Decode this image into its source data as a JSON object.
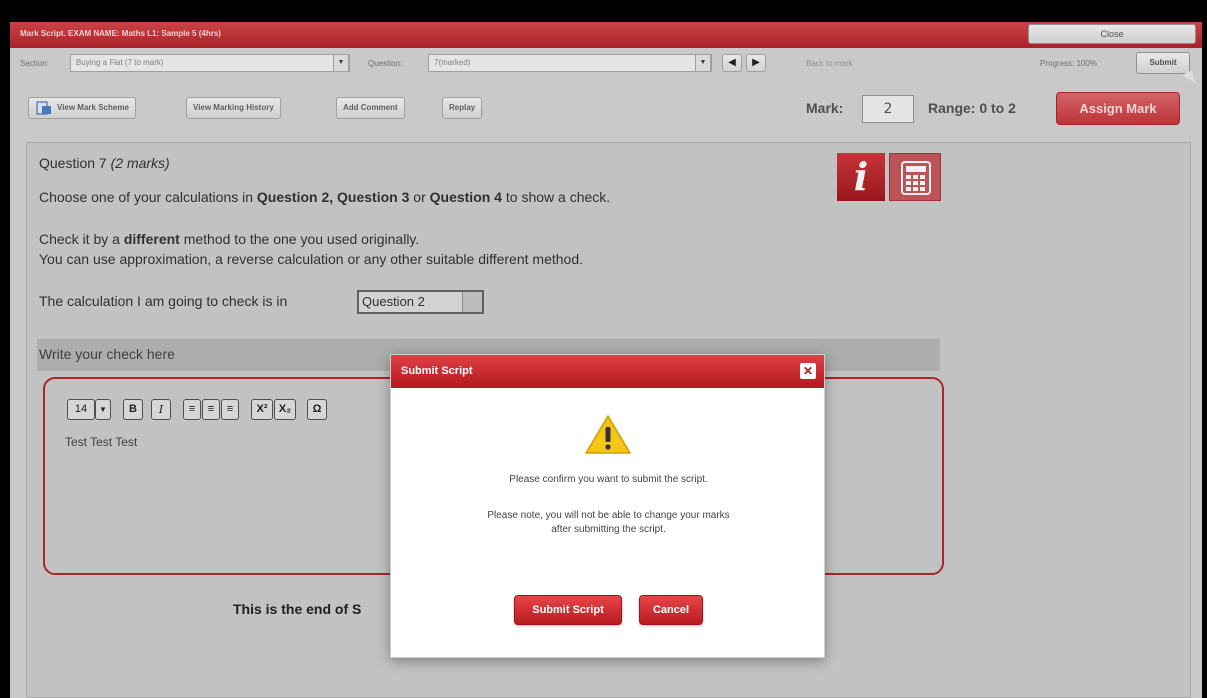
{
  "window": {
    "title": "Mark Script. EXAM NAME: Maths L1: Sample 5 (4hrs)",
    "close_label": "Close"
  },
  "toolbar": {
    "section_label": "Section:",
    "section_value": "Buying a Flat (7 to mark)",
    "question_label": "Question:",
    "question_value": "7(marked)",
    "prev_icon": "◀",
    "next_icon": "▶",
    "back_to_mark": "Back to mark",
    "progress": "Progress: 100%",
    "submit_label": "Submit",
    "view_mark_scheme": "View Mark Scheme",
    "view_marking_history": "View Marking History",
    "add_comment": "Add Comment",
    "replay": "Replay",
    "mark_label": "Mark:",
    "mark_value": "2",
    "range_label": "Range: 0 to 2",
    "assign_mark": "Assign Mark"
  },
  "question": {
    "title": "Question 7",
    "marks": "(2 marks)",
    "line1_pre": "Choose one of your calculations in ",
    "line1_q2": "Question 2, Question 3",
    "line1_or": " or ",
    "line1_q4": "Question 4",
    "line1_post": " to show a check.",
    "line2_pre": "Check it by a ",
    "line2_bold": "different",
    "line2_post": " method to the one you used originally.",
    "line3": "You can use approximation, a reverse calculation or any other suitable different method.",
    "calc_label": "The calculation I am going to check is in",
    "calc_value": "Question 2",
    "check_header": "Write your check here",
    "answer_text": "Test Test Test",
    "end_text": "This is the end of S"
  },
  "editor": {
    "font_size": "14",
    "bold": "B",
    "italic": "I",
    "align_left": "≡",
    "align_center": "≡",
    "align_right": "≡",
    "superscript": "X²",
    "subscript": "X₂",
    "special": "Ω"
  },
  "modal": {
    "title": "Submit Script",
    "close_icon": "✕",
    "message1": "Please confirm you want to submit the script.",
    "message2": "Please note, you will not be able to change your marks",
    "message3": "after submitting the script.",
    "submit_label": "Submit Script",
    "cancel_label": "Cancel"
  },
  "colors": {
    "accent": "#c1272d",
    "background": "#d6d6d6"
  }
}
